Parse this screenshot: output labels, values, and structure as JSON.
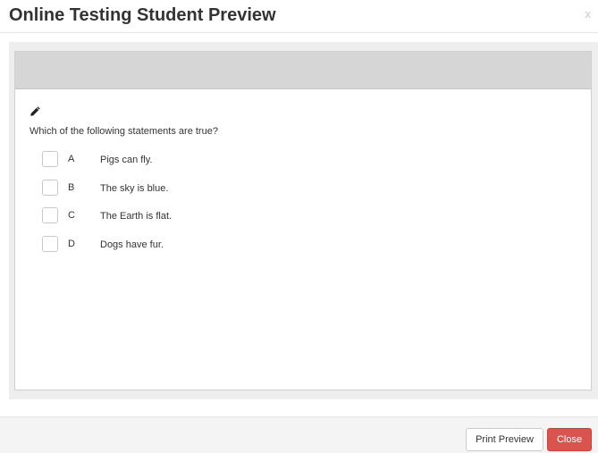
{
  "modal": {
    "title": "Online Testing Student Preview",
    "close_glyph": "x"
  },
  "question": {
    "icon": "pencil-icon",
    "text": "Which of the following statements are true?",
    "options": [
      {
        "letter": "A",
        "text": "Pigs can fly.",
        "checked": false
      },
      {
        "letter": "B",
        "text": "The sky is blue.",
        "checked": false
      },
      {
        "letter": "C",
        "text": "The Earth is flat.",
        "checked": false
      },
      {
        "letter": "D",
        "text": "Dogs have fur.",
        "checked": false
      }
    ]
  },
  "footer": {
    "print_preview_label": "Print Preview",
    "close_label": "Close"
  },
  "colors": {
    "close_button": "#d9534f",
    "frame_header": "#d6d6d6",
    "body_background": "#eeeeee"
  }
}
